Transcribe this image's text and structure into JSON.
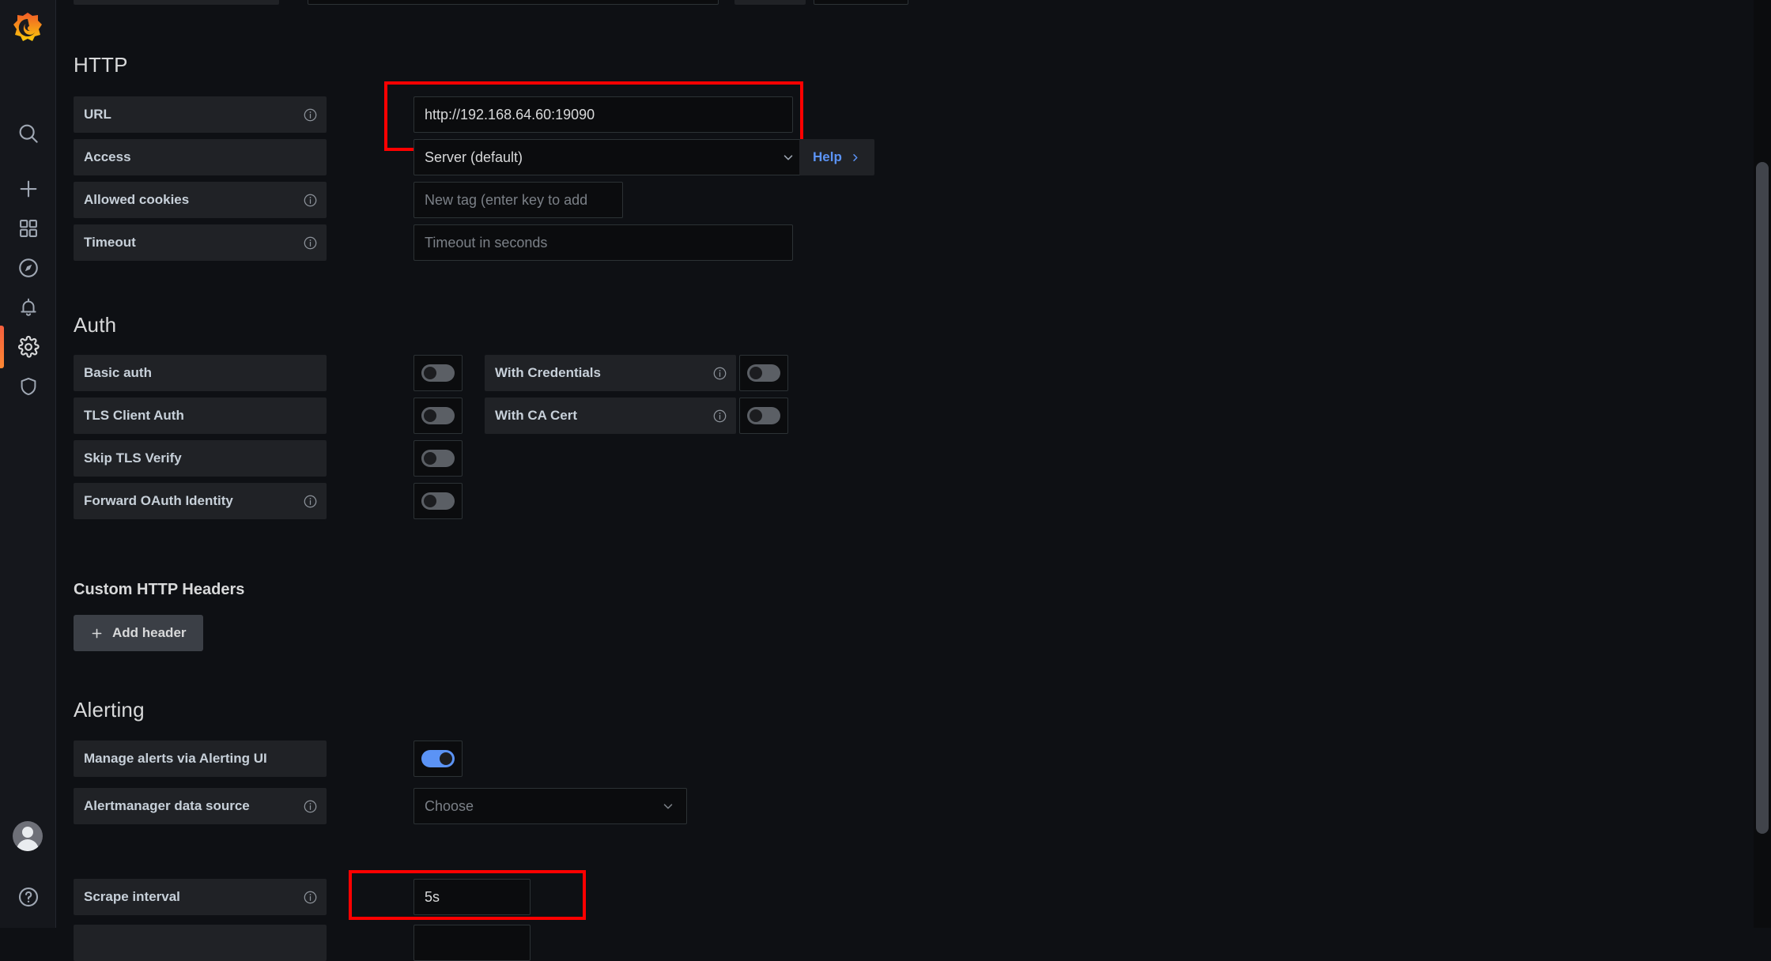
{
  "app": {
    "name": "Grafana",
    "accent_orange": "#f55f3e",
    "accent_blue": "#5b93f5",
    "annotation_color": "#fe0000"
  },
  "sidebar": {
    "logo_name": "grafana-logo",
    "items": [
      {
        "icon": "search-icon",
        "label": "Search",
        "active": false
      },
      {
        "icon": "plus-icon",
        "label": "Create",
        "active": false
      },
      {
        "icon": "dashboards-icon",
        "label": "Dashboards",
        "active": false
      },
      {
        "icon": "compass-icon",
        "label": "Explore",
        "active": false
      },
      {
        "icon": "bell-icon",
        "label": "Alerting",
        "active": false
      },
      {
        "icon": "gear-icon",
        "label": "Configuration",
        "active": true
      },
      {
        "icon": "shield-icon",
        "label": "Server Admin",
        "active": false
      }
    ],
    "avatar_label": "User profile",
    "help_label": "Help"
  },
  "sections": {
    "http": {
      "title": "HTTP",
      "fields": {
        "url": {
          "label": "URL",
          "has_info": true,
          "value": "http://192.168.64.60:19090",
          "highlighted": true
        },
        "access": {
          "label": "Access",
          "has_info": false,
          "value": "Server (default)",
          "type": "select"
        },
        "cookies": {
          "label": "Allowed cookies",
          "has_info": true,
          "placeholder": "New tag (enter key to add"
        },
        "timeout": {
          "label": "Timeout",
          "has_info": true,
          "placeholder": "Timeout in seconds"
        }
      },
      "help_button": "Help"
    },
    "auth": {
      "title": "Auth",
      "left_toggles": [
        {
          "label": "Basic auth",
          "has_info": false,
          "on": false
        },
        {
          "label": "TLS Client Auth",
          "has_info": false,
          "on": false
        },
        {
          "label": "Skip TLS Verify",
          "has_info": false,
          "on": false
        },
        {
          "label": "Forward OAuth Identity",
          "has_info": true,
          "on": false
        }
      ],
      "right_toggles": [
        {
          "label": "With Credentials",
          "has_info": true,
          "on": false
        },
        {
          "label": "With CA Cert",
          "has_info": true,
          "on": false
        }
      ]
    },
    "custom_headers": {
      "title": "Custom HTTP Headers",
      "add_button": "Add header"
    },
    "alerting": {
      "title": "Alerting",
      "manage": {
        "label": "Manage alerts via Alerting UI",
        "has_info": false,
        "on": true
      },
      "alertmanager": {
        "label": "Alertmanager data source",
        "has_info": true,
        "placeholder": "Choose",
        "type": "select"
      }
    },
    "scrape": {
      "interval": {
        "label": "Scrape interval",
        "has_info": true,
        "value": "5s",
        "highlighted": true
      }
    }
  },
  "scrollbar": {
    "name": "vertical-scrollbar"
  }
}
